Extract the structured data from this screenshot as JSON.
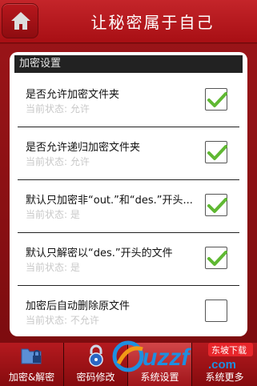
{
  "header": {
    "title": "让秘密属于自己",
    "home_icon": "home-icon"
  },
  "section": {
    "title": "加密设置"
  },
  "settings": [
    {
      "title": "是否允许加密文件夹",
      "status": "当前状态: 允许",
      "checked": true
    },
    {
      "title": "是否允许递归加密文件夹",
      "status": "当前状态: 允许",
      "checked": true
    },
    {
      "title": "默认只加密非“out.”和“des.”开头...",
      "status": "当前状态: 是",
      "checked": true
    },
    {
      "title": "默认只解密以“des.”开头的文件",
      "status": "当前状态: 是",
      "checked": true
    },
    {
      "title": "加密后自动删除原文件",
      "status": "当前状态: 不允许",
      "checked": false
    }
  ],
  "tabs": [
    {
      "label": "加密&解密",
      "icon": "folder-lock-icon",
      "active": false
    },
    {
      "label": "密码修改",
      "icon": "padlock-icon",
      "active": false
    },
    {
      "label": "系统设置",
      "icon": "settings-icon",
      "active": true
    },
    {
      "label": "系统更多",
      "icon": "more-icon",
      "active": false
    }
  ],
  "watermark": {
    "brand": "uzzf",
    "domain": ".com",
    "tagline": "东坡下载"
  },
  "colors": {
    "accent": "#b3171c",
    "check": "#5fb832",
    "status_text": "#c8c8c8"
  }
}
